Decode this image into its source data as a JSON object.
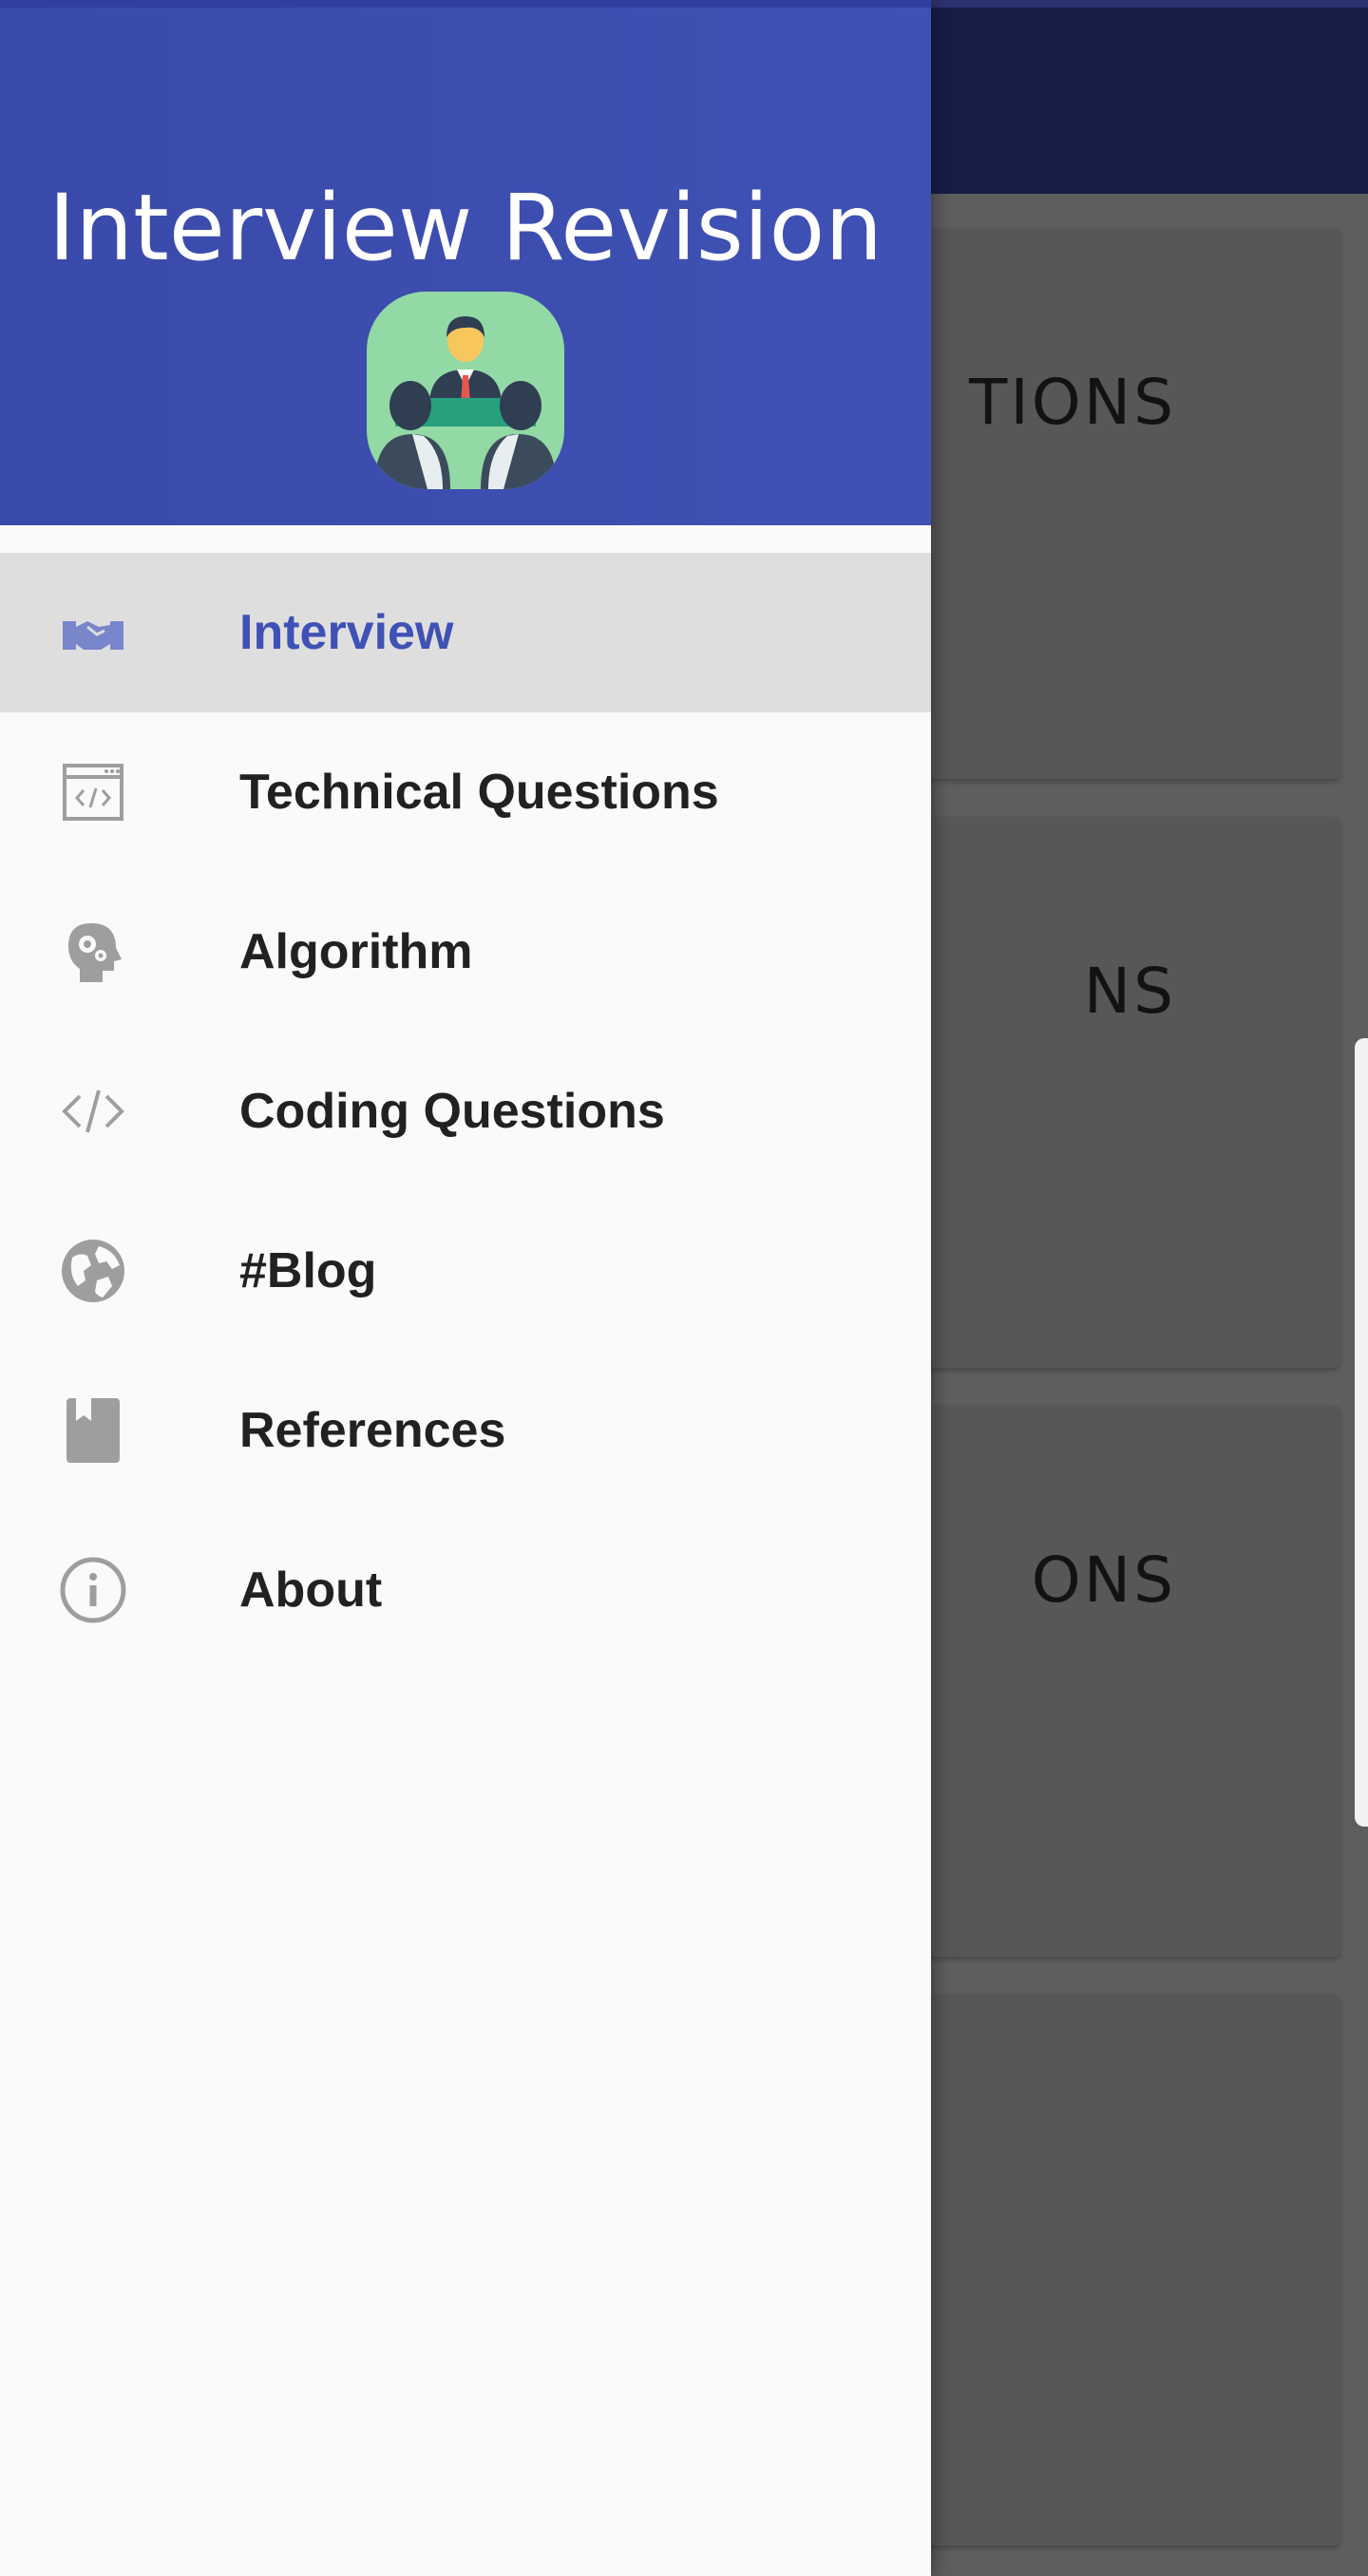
{
  "background": {
    "cards": [
      {
        "title_fragment": "TIONS"
      },
      {
        "title_fragment": "NS"
      },
      {
        "title_fragment": "ONS"
      },
      {
        "title_fragment": ""
      }
    ]
  },
  "drawer": {
    "header": {
      "title": "Interview Revision",
      "avatar_icon": "interview-panel-icon"
    },
    "items": [
      {
        "label": "Interview",
        "icon": "handshake-icon",
        "selected": true
      },
      {
        "label": "Technical Questions",
        "icon": "code-window-icon",
        "selected": false
      },
      {
        "label": "Algorithm",
        "icon": "head-gear-icon",
        "selected": false
      },
      {
        "label": "Coding Questions",
        "icon": "code-brackets-icon",
        "selected": false
      },
      {
        "label": "#Blog",
        "icon": "globe-icon",
        "selected": false
      },
      {
        "label": "References",
        "icon": "book-icon",
        "selected": false
      },
      {
        "label": "About",
        "icon": "info-icon",
        "selected": false
      }
    ]
  },
  "colors": {
    "primary": "#3f51b5",
    "primary_dark": "#303f9f",
    "selected_bg": "#dedede",
    "icon_grey": "#9e9e9e",
    "text_dark": "#212121"
  }
}
